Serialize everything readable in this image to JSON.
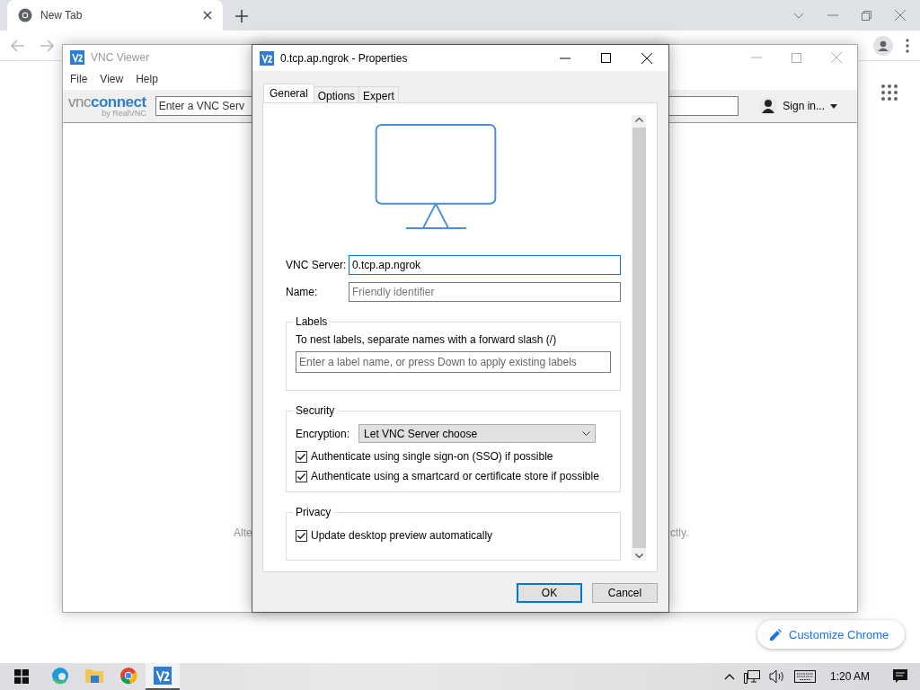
{
  "browser": {
    "tabs": [
      {
        "title": "New Tab",
        "selected": true
      }
    ],
    "customize_button": "Customize Chrome"
  },
  "viewer_window": {
    "title": "VNC Viewer",
    "active": false,
    "menu": [
      "File",
      "View",
      "Help"
    ],
    "logo_prefix": "vnc",
    "logo_main": "connect",
    "logo_byline": "by RealVNC",
    "search": {
      "placeholder": "Enter a VNC Serv"
    },
    "sign_in": "Sign in...",
    "body_fragments": [
      "Alte",
      "ctly."
    ]
  },
  "properties_dialog": {
    "title": "0.tcp.ap.ngrok - Properties",
    "active": true,
    "tabs": [
      {
        "label": "General",
        "selected": true
      },
      {
        "label": "Options",
        "selected": false
      },
      {
        "label": "Expert",
        "selected": false
      }
    ],
    "fields": [
      {
        "label": "VNC Server:",
        "value": "0.tcp.ap.ngrok",
        "focused": true
      },
      {
        "label": "Name:",
        "placeholder": "Friendly identifier",
        "focused": false
      }
    ],
    "labels_group": {
      "title": "Labels",
      "hint": "To nest labels, separate names with a forward slash (/)",
      "placeholder": "Enter a label name, or press Down to apply existing labels"
    },
    "security_group": {
      "title": "Security",
      "encryption_label": "Encryption:",
      "encryption_value": "Let VNC Server choose",
      "options": [
        {
          "label": "Authenticate using single sign-on (SSO) if possible",
          "checked": true
        },
        {
          "label": "Authenticate using a smartcard or certificate store if possible",
          "checked": true
        }
      ]
    },
    "privacy_group": {
      "title": "Privacy",
      "options": [
        {
          "label": "Update desktop preview automatically",
          "checked": true
        }
      ]
    },
    "buttons": [
      {
        "label": "OK",
        "default": true
      },
      {
        "label": "Cancel",
        "default": false
      }
    ]
  },
  "taskbar": {
    "apps": [
      {
        "kind": "edge",
        "selected": false
      },
      {
        "kind": "explorer",
        "selected": false
      },
      {
        "kind": "chrome",
        "selected": false
      },
      {
        "kind": "vnc",
        "selected": true
      }
    ],
    "clock": "1:20 AM"
  }
}
